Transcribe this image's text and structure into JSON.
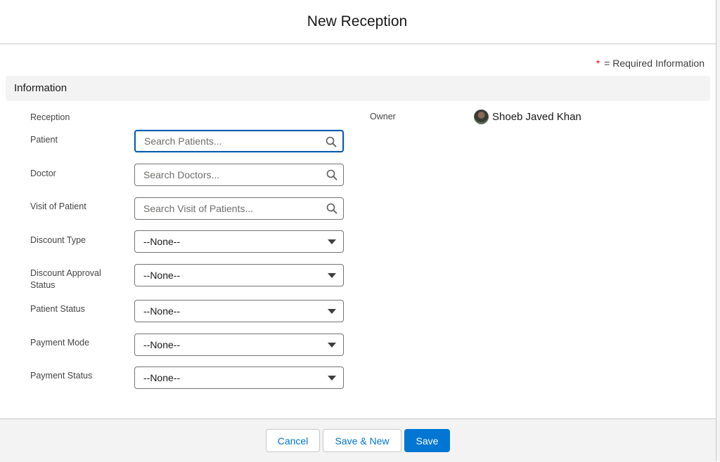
{
  "modal": {
    "title": "New Reception",
    "required_star": "*",
    "required_text": "= Required Information"
  },
  "section": {
    "title": "Information"
  },
  "fields": {
    "reception_label": "Reception",
    "patient": {
      "label": "Patient",
      "placeholder": "Search Patients...",
      "value": "",
      "icon": "search-icon"
    },
    "doctor": {
      "label": "Doctor",
      "placeholder": "Search Doctors...",
      "value": "",
      "icon": "search-icon"
    },
    "visit_of_patient": {
      "label": "Visit of Patient",
      "placeholder": "Search Visit of Patients...",
      "value": "",
      "icon": "search-icon"
    },
    "discount_type": {
      "label": "Discount Type",
      "value": "--None--"
    },
    "discount_approval_status": {
      "label_line1": "Discount Approval",
      "label_line2": "Status",
      "value": "--None--"
    },
    "patient_status": {
      "label": "Patient Status",
      "value": "--None--"
    },
    "payment_mode": {
      "label": "Payment Mode",
      "value": "--None--"
    },
    "payment_status": {
      "label": "Payment Status",
      "value": "--None--"
    }
  },
  "owner": {
    "label": "Owner",
    "name": "Shoeb Javed Khan"
  },
  "footer": {
    "cancel_label": "Cancel",
    "save_new_label": "Save & New",
    "save_label": "Save"
  },
  "colors": {
    "brand": "#0176d3",
    "focus_border": "#0b5cab",
    "required": "#ea001e",
    "section_bg": "#f3f3f3"
  }
}
